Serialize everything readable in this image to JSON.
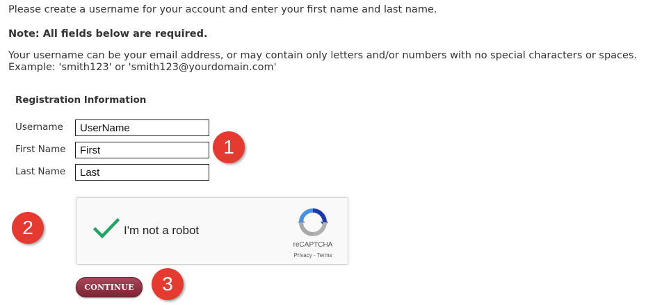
{
  "instructions": {
    "intro": "Please create a username for your account and enter your first name and last name.",
    "note": "Note: All fields below are required.",
    "username_note_line1": "Your username can be your email address, or may contain only letters and/or numbers with no special characters or spaces.",
    "username_note_line2": "Example: 'smith123' or 'smith123@yourdomain.com'"
  },
  "registration": {
    "heading": "Registration Information",
    "fields": [
      {
        "label": "Username",
        "value": "UserName"
      },
      {
        "label": "First Name",
        "value": "First"
      },
      {
        "label": "Last Name",
        "value": "Last"
      }
    ]
  },
  "captcha": {
    "label": "I'm not a robot",
    "brand": "reCAPTCHA",
    "privacy": "Privacy",
    "separator": " - ",
    "terms": "Terms",
    "checked": true,
    "check_icon": "check-icon",
    "logo_icon": "recaptcha-logo-icon"
  },
  "continue_label": "CONTINUE",
  "step_badges": [
    "1",
    "2",
    "3"
  ],
  "colors": {
    "badge": "#e53a30",
    "button": "#8e3344",
    "check": "#1fa463",
    "text": "#333333"
  }
}
